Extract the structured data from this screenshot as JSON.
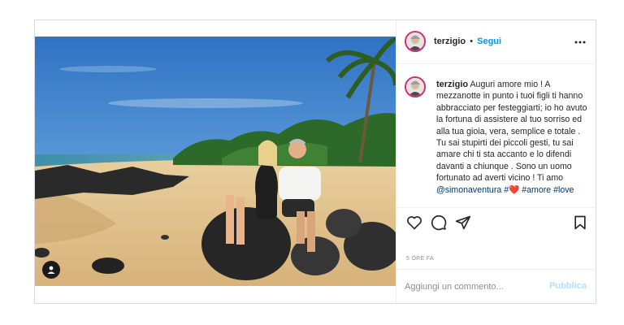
{
  "post": {
    "username": "terzigio",
    "separator": "•",
    "follow_label": "Segui",
    "caption": {
      "username": "terzigio",
      "text_1": " Auguri amore mio ! A mezzanotte in punto i tuoi figli ti hanno abbracciato per festeggiarti; io ho avuto la fortuna di assistere al tuo sorriso ed alla tua gioia, vera, semplice e totale .",
      "text_2": "Tu sai stupirti dei piccoli gesti, tu sai amare chi ti sta accanto e lo difendi davanti a chiunque . Sono un uomo fortunato ad averti vicino ! Ti amo",
      "mention": "@simonaventura",
      "hashtag_sep": " #",
      "heart": "❤️",
      "tag_amore": "#amore",
      "tag_love": "#love"
    },
    "timestamp": "5 ORE FA",
    "comment": {
      "placeholder": "Aggiungi un commento...",
      "publish_label": "Pubblica"
    }
  },
  "icons": {
    "more": "more-options-icon",
    "like": "heart-outline-icon",
    "comment": "comment-bubble-icon",
    "share": "paper-plane-icon",
    "save": "bookmark-icon",
    "tagged": "user-tag-icon"
  },
  "colors": {
    "link_blue": "#0095f6",
    "mention": "#00376b",
    "avatar_ring": "#d62976",
    "publish_disabled": "#b2dffc",
    "muted": "#8e8e8e"
  }
}
